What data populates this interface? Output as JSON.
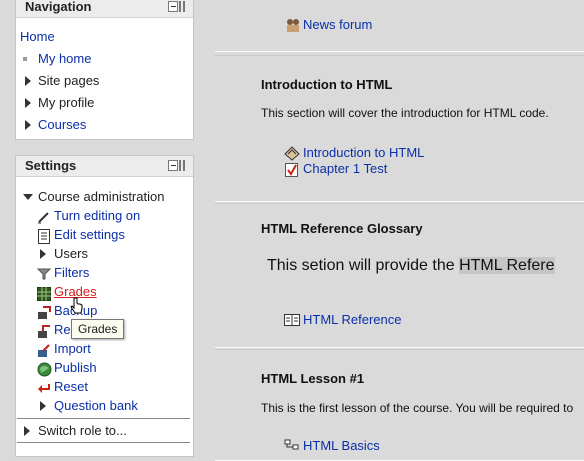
{
  "navigation": {
    "title": "Navigation",
    "home": "Home",
    "items": [
      {
        "label": "My home",
        "type": "link",
        "icon": "bullet-icon"
      },
      {
        "label": "Site pages",
        "type": "text",
        "icon": "expand-arrow-icon"
      },
      {
        "label": "My profile",
        "type": "text",
        "icon": "expand-arrow-icon"
      },
      {
        "label": "Courses",
        "type": "link",
        "icon": "expand-arrow-icon"
      }
    ]
  },
  "settings": {
    "title": "Settings",
    "course_admin": "Course administration",
    "items": [
      {
        "label": "Turn editing on",
        "icon": "edit-pen-icon"
      },
      {
        "label": "Edit settings",
        "icon": "settings-doc-icon"
      },
      {
        "label": "Users",
        "icon": "expand-arrow-icon"
      },
      {
        "label": "Filters",
        "icon": "filter-icon"
      },
      {
        "label": "Grades",
        "icon": "grades-icon"
      },
      {
        "label": "Backup",
        "icon": "backup-icon"
      },
      {
        "label": "Restore",
        "icon": "restore-icon"
      },
      {
        "label": "Import",
        "icon": "import-icon"
      },
      {
        "label": "Publish",
        "icon": "publish-icon"
      },
      {
        "label": "Reset",
        "icon": "reset-icon"
      },
      {
        "label": "Question bank",
        "icon": "expand-arrow-icon"
      }
    ],
    "switch_role": "Switch role to...",
    "tooltip": "Grades"
  },
  "sections": [
    {
      "activities": [
        {
          "label": "News forum",
          "icon": "forum-icon"
        }
      ]
    },
    {
      "title": "Introduction to HTML",
      "summary": "This section will cover the introduction for HTML code.",
      "activities": [
        {
          "label": "Introduction to HTML",
          "icon": "lesson-icon"
        },
        {
          "label": "Chapter 1 Test",
          "icon": "quiz-icon"
        }
      ]
    },
    {
      "title": "HTML Reference Glossary",
      "summary_plain": "This setion will provide the ",
      "summary_highlight": "HTML Refere",
      "activities": [
        {
          "label": "HTML Reference",
          "icon": "glossary-icon"
        }
      ]
    },
    {
      "title": "HTML Lesson #1",
      "summary": "This is the first lesson of the course. You will be required to",
      "activities": [
        {
          "label": "HTML Basics",
          "icon": "lesson-tree-icon"
        }
      ]
    }
  ],
  "colors": {
    "link": "#0b2fa8",
    "hover_link": "#d11d1d",
    "page_bg": "#dadada"
  }
}
